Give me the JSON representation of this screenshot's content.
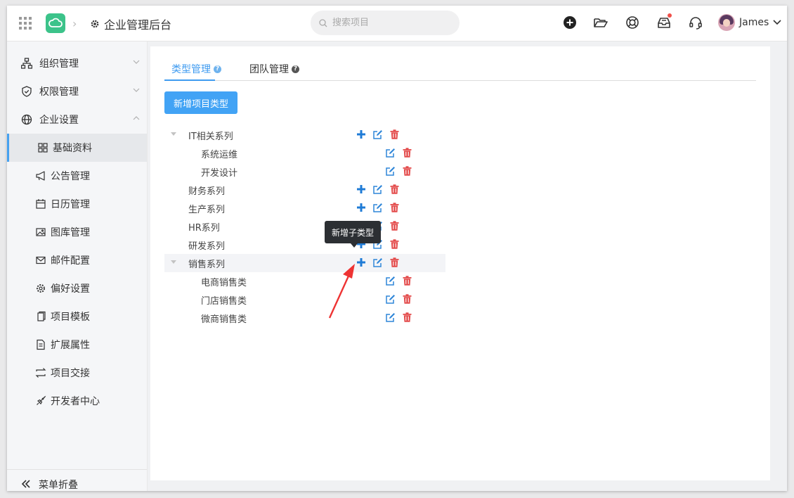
{
  "header": {
    "app_title": "企业管理后台",
    "search_placeholder": "搜索项目",
    "user_name": "James",
    "colors": {
      "accent": "#42a3f5",
      "logo": "#3cc38a",
      "notification": "#f0504a"
    }
  },
  "sidebar": {
    "groups": [
      {
        "label": "组织管理",
        "icon": "org-chart-icon",
        "expanded": false
      },
      {
        "label": "权限管理",
        "icon": "shield-icon",
        "expanded": false
      },
      {
        "label": "企业设置",
        "icon": "globe-icon",
        "expanded": true
      }
    ],
    "sub_items": [
      {
        "label": "基础资料",
        "icon": "grid-icon",
        "active": true
      },
      {
        "label": "公告管理",
        "icon": "megaphone-icon"
      },
      {
        "label": "日历管理",
        "icon": "calendar-icon"
      },
      {
        "label": "图库管理",
        "icon": "image-icon"
      },
      {
        "label": "邮件配置",
        "icon": "mail-icon"
      },
      {
        "label": "偏好设置",
        "icon": "gear-icon"
      },
      {
        "label": "项目模板",
        "icon": "copy-icon"
      },
      {
        "label": "扩展属性",
        "icon": "document-icon"
      },
      {
        "label": "项目交接",
        "icon": "swap-icon"
      },
      {
        "label": "开发者中心",
        "icon": "rocket-icon"
      }
    ],
    "collapse_label": "菜单折叠"
  },
  "main": {
    "tabs": [
      {
        "label": "类型管理",
        "active": true
      },
      {
        "label": "团队管理",
        "active": false
      }
    ],
    "add_button_label": "新增项目类型",
    "tree": [
      {
        "label": "IT相关系列",
        "level": 0,
        "expanded": true,
        "can_add": true
      },
      {
        "label": "系统运维",
        "level": 1,
        "can_add": false
      },
      {
        "label": "开发设计",
        "level": 1,
        "can_add": false
      },
      {
        "label": "财务系列",
        "level": 0,
        "can_add": true
      },
      {
        "label": "生产系列",
        "level": 0,
        "can_add": true
      },
      {
        "label": "HR系列",
        "level": 0,
        "can_add": true
      },
      {
        "label": "研发系列",
        "level": 0,
        "can_add": true
      },
      {
        "label": "销售系列",
        "level": 0,
        "expanded": true,
        "can_add": true,
        "highlighted": true
      },
      {
        "label": "电商销售类",
        "level": 1,
        "can_add": false
      },
      {
        "label": "门店销售类",
        "level": 1,
        "can_add": false
      },
      {
        "label": "微商销售类",
        "level": 1,
        "can_add": false
      }
    ],
    "tooltip": "新增子类型"
  }
}
